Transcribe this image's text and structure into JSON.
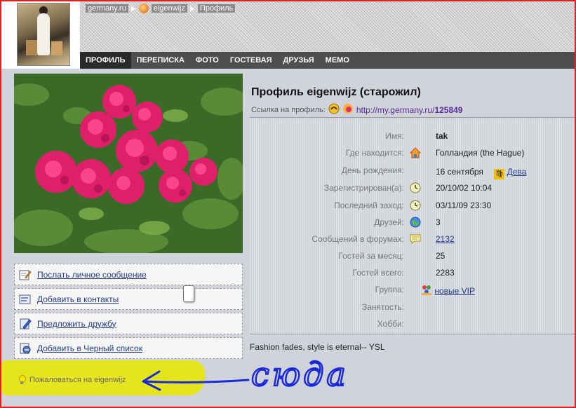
{
  "breadcrumbs": {
    "site": "germany.ru",
    "user": "eigenwijz",
    "page": "Профиль"
  },
  "nav": {
    "items": [
      {
        "label": "ПРОФИЛЬ",
        "active": true
      },
      {
        "label": "ПЕРЕПИСКА"
      },
      {
        "label": "ФОТО"
      },
      {
        "label": "ГОСТЕВАЯ"
      },
      {
        "label": "ДРУЗЬЯ"
      },
      {
        "label": "МЕМО"
      }
    ]
  },
  "profile": {
    "title": "Профиль eigenwijz (старожил)",
    "link_label": "Ссылка на профиль:",
    "link_prefix": "http://my.germany.ru/",
    "link_id": "125849"
  },
  "fields": {
    "name": {
      "label": "Имя:",
      "value": "tak"
    },
    "location": {
      "label": "Где находится:",
      "value": "Голландия (the Hague)",
      "icon": "house-icon"
    },
    "birthday": {
      "label": "День рождения:",
      "value": "16 сентября",
      "zodiac": "Дева",
      "zodiac_glyph": "♍"
    },
    "registered": {
      "label": "Зарегистрирован(а):",
      "value": "20/10/02 10:04",
      "icon": "clock-icon"
    },
    "last_visit": {
      "label": "Последний заход:",
      "value": "03/11/09 23:30",
      "icon": "clock-icon"
    },
    "friends": {
      "label": "Друзей:",
      "value": "3",
      "icon": "globe-icon"
    },
    "forum_posts": {
      "label": "Сообщений в форумах:",
      "value": "2132",
      "icon": "speech-bubble-icon"
    },
    "guests_month": {
      "label": "Гостей за месяц:",
      "value": "25"
    },
    "guests_total": {
      "label": "Гостей всего:",
      "value": "2283"
    },
    "group": {
      "label": "Группа:",
      "value": "новые VIP",
      "icon": "group-icon"
    },
    "occupation": {
      "label": "Занятость:",
      "value": ""
    },
    "hobbies": {
      "label": "Хобби:",
      "value": ""
    }
  },
  "motto": "Fashion fades, style is eternal-- YSL",
  "actions": {
    "send_message": "Послать личное сообщение",
    "add_contacts": "Добавить в контакты",
    "offer_friendship": "Предложить дружбу",
    "add_blacklist": "Добавить в Черный список"
  },
  "complain": "Пожаловаться на eigenwijz",
  "annotation": "сюда",
  "colors": {
    "highlight": "#e6e614",
    "annotation_ink": "#1a2ad8",
    "frame": "#e02020",
    "navbar": "#4e4e4e",
    "link": "#223a8a"
  }
}
